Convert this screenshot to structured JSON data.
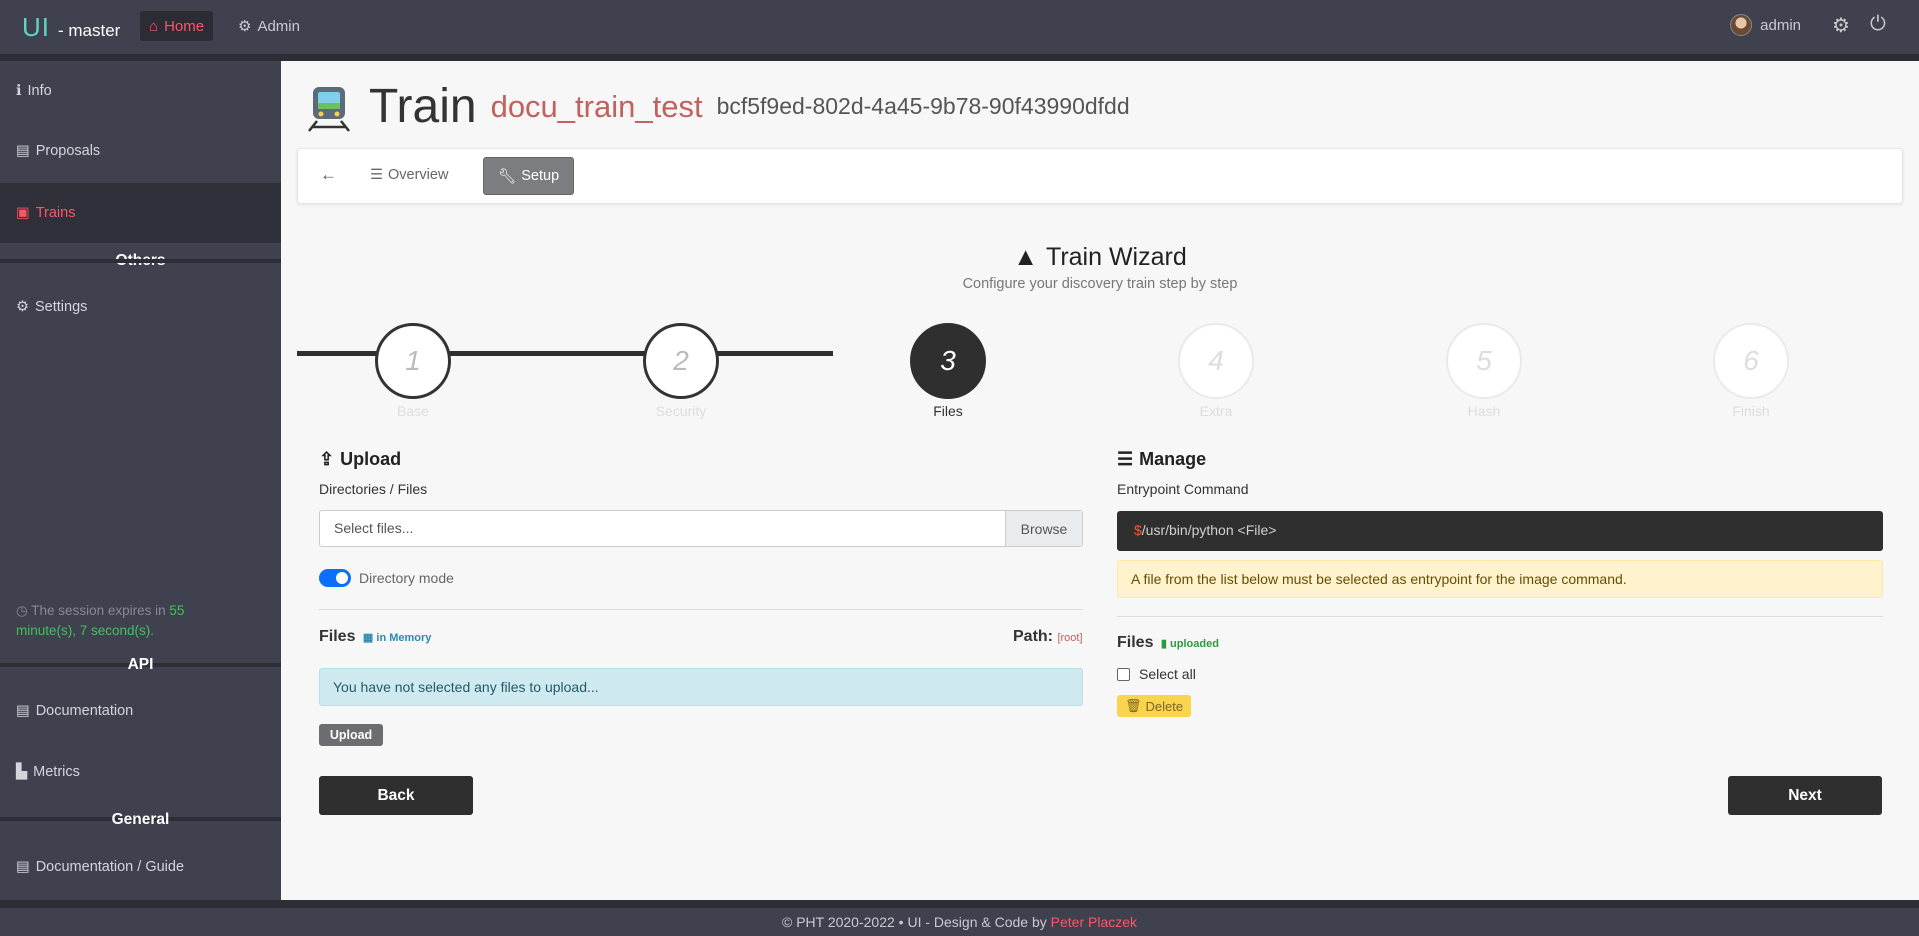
{
  "brand": {
    "logo": "UI",
    "suffix": "- master"
  },
  "topnav": {
    "home": "Home",
    "admin": "Admin",
    "user": "admin"
  },
  "sidebar": {
    "items": [
      {
        "label": "Info",
        "icon": "info-icon"
      },
      {
        "label": "Proposals",
        "icon": "file-icon"
      },
      {
        "label": "Trains",
        "icon": "train-icon",
        "active": true
      }
    ],
    "others_heading": "Others",
    "settings": "Settings",
    "session": {
      "prefix": "The session expires in",
      "time": "55 minute(s), 7 second(s)."
    },
    "api_heading": "API",
    "documentation": "Documentation",
    "metrics": "Metrics",
    "general_heading": "General",
    "guide": "Documentation / Guide"
  },
  "page": {
    "title": "Train",
    "train_name": "docu_train_test",
    "train_id": "bcf5f9ed-802d-4a45-9b78-90f43990dfdd"
  },
  "tabs": {
    "overview": "Overview",
    "setup": "Setup"
  },
  "wizard": {
    "title": "Train Wizard",
    "subtitle": "Configure your discovery train step by step",
    "steps": [
      {
        "num": "1",
        "label": "Base"
      },
      {
        "num": "2",
        "label": "Security"
      },
      {
        "num": "3",
        "label": "Files"
      },
      {
        "num": "4",
        "label": "Extra"
      },
      {
        "num": "5",
        "label": "Hash"
      },
      {
        "num": "6",
        "label": "Finish"
      }
    ],
    "active_step": 3
  },
  "upload": {
    "title": "Upload",
    "label": "Directories / Files",
    "placeholder": "Select files...",
    "browse": "Browse",
    "directory_mode": "Directory mode",
    "files_title": "Files",
    "files_badge": "in Memory",
    "path_label": "Path:",
    "path_value": "[root]",
    "empty_message": "You have not selected any files to upload...",
    "upload_button": "Upload"
  },
  "manage": {
    "title": "Manage",
    "label": "Entrypoint Command",
    "command_prefix": "$",
    "command": "/usr/bin/python <File>",
    "warning": "A file from the list below must be selected as entrypoint for the image command.",
    "files_title": "Files",
    "files_badge": "uploaded",
    "select_all": "Select all",
    "delete_button": "Delete"
  },
  "buttons": {
    "back": "Back",
    "next": "Next"
  },
  "footer": {
    "text": "© PHT 2020-2022 • UI - Design & Code by",
    "author": "Peter Placzek"
  },
  "colors": {
    "accent": "#ff5566",
    "sidebar": "#3f414f",
    "dark_button": "#2f2f2f"
  }
}
